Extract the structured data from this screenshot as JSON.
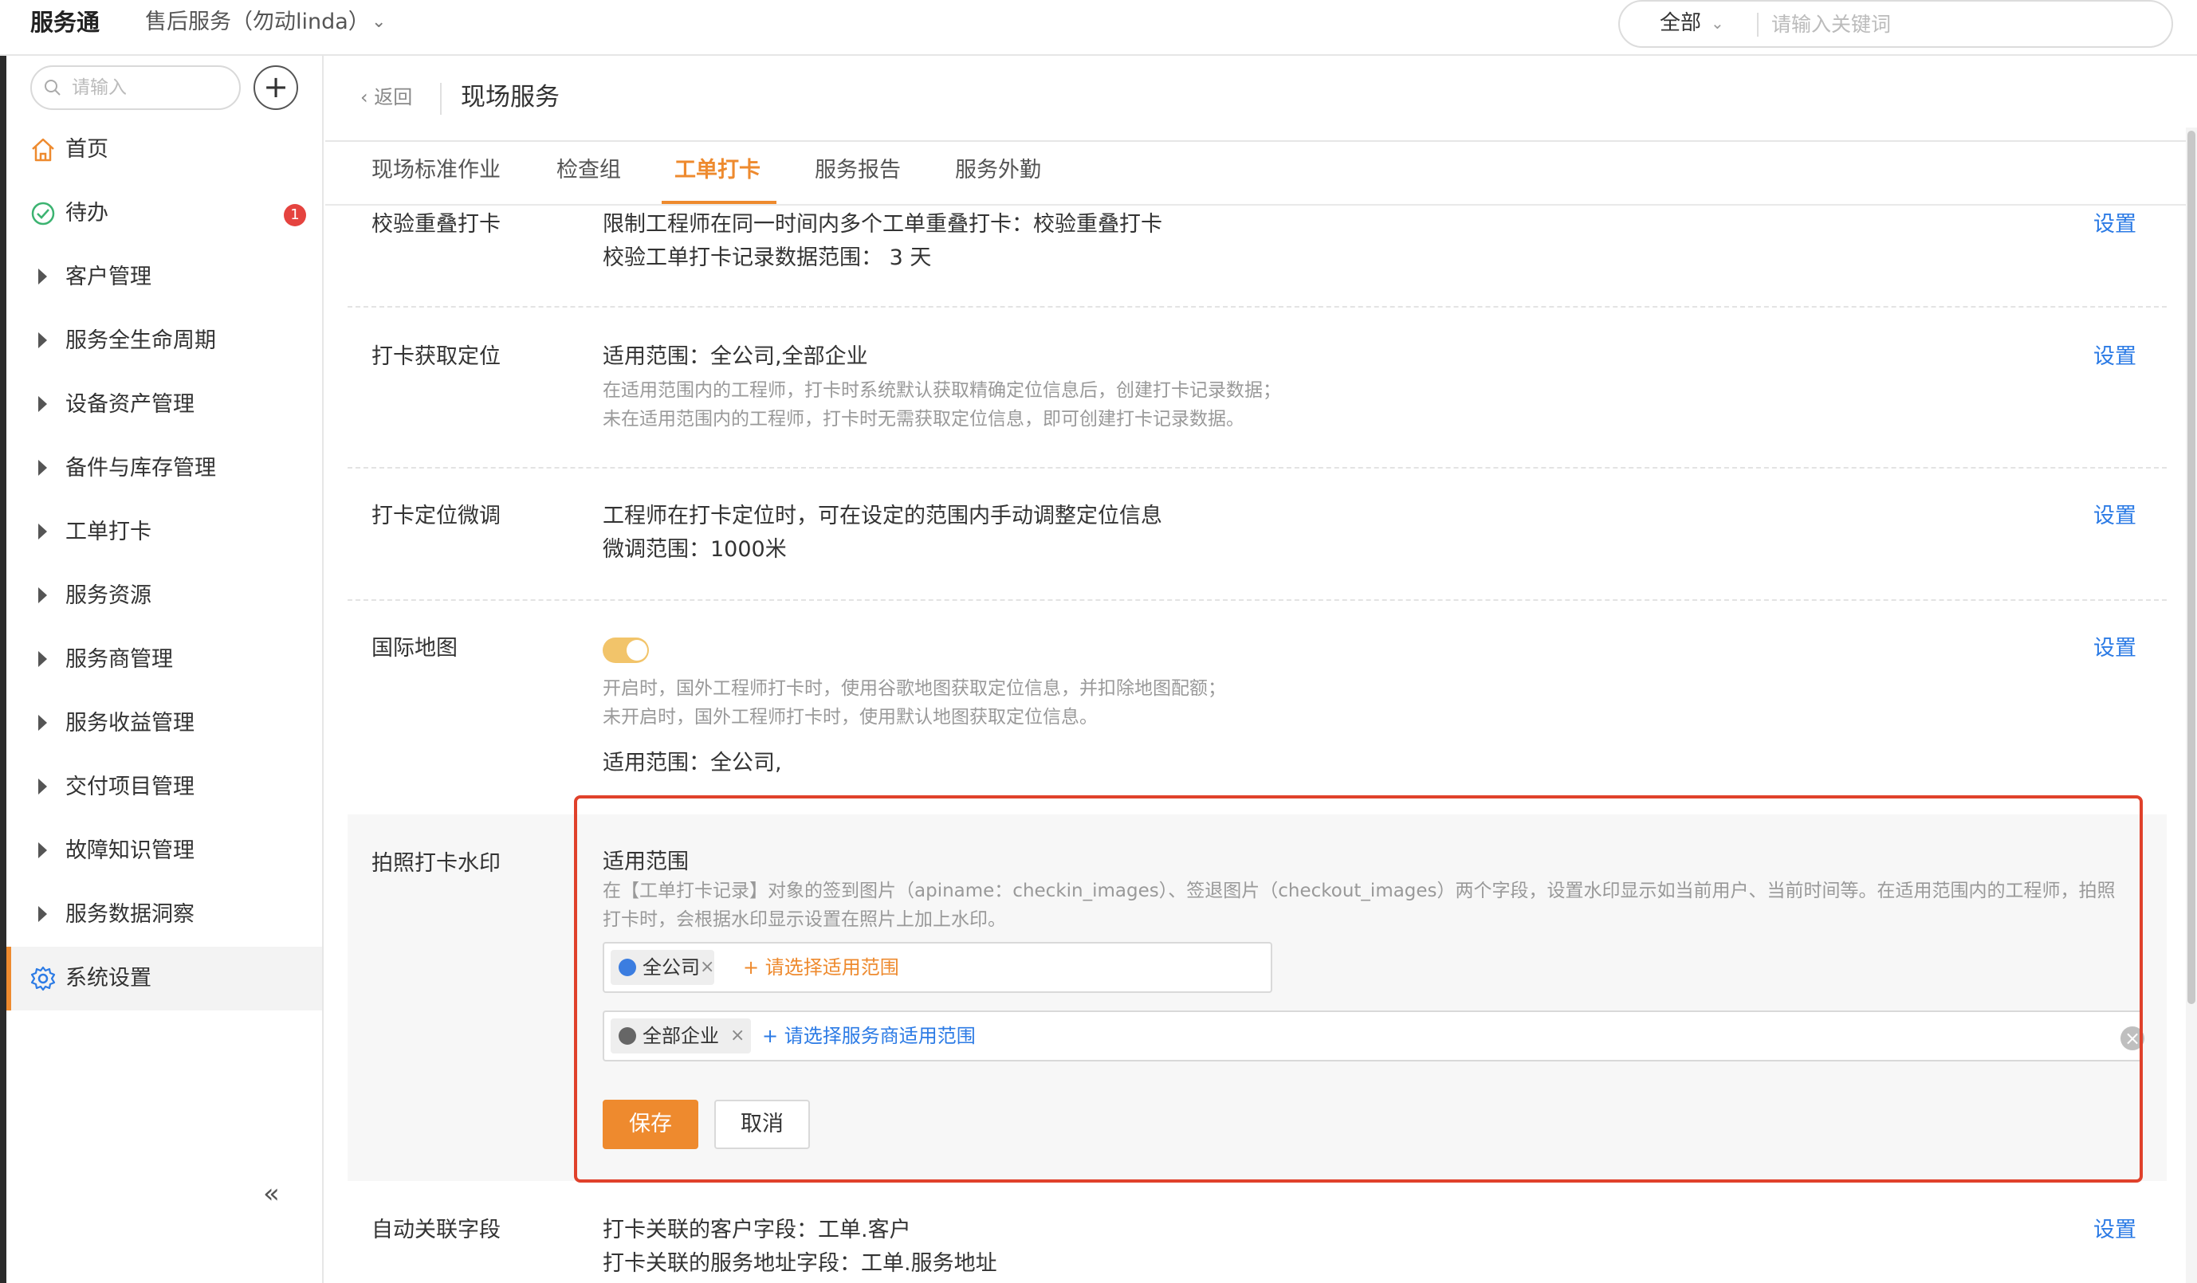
{
  "topbar": {
    "brand": "服务通",
    "tenant": "售后服务（勿动linda）",
    "scope": "全部",
    "search_placeholder": "请输入关键词"
  },
  "sidebar": {
    "search_placeholder": "请输入",
    "todo_badge": "1",
    "items": [
      {
        "label": "首页",
        "icon": "home-icon"
      },
      {
        "label": "待办",
        "icon": "check-circle-icon"
      },
      {
        "label": "客户管理"
      },
      {
        "label": "服务全生命周期"
      },
      {
        "label": "设备资产管理"
      },
      {
        "label": "备件与库存管理"
      },
      {
        "label": "工单打卡"
      },
      {
        "label": "服务资源"
      },
      {
        "label": "服务商管理"
      },
      {
        "label": "服务收益管理"
      },
      {
        "label": "交付项目管理"
      },
      {
        "label": "故障知识管理"
      },
      {
        "label": "服务数据洞察"
      },
      {
        "label": "系统设置",
        "icon": "gear-icon"
      }
    ]
  },
  "header": {
    "back": "返回",
    "title": "现场服务"
  },
  "tabs": [
    "现场标准作业",
    "检查组",
    "工单打卡",
    "服务报告",
    "服务外勤"
  ],
  "active_tab": "工单打卡",
  "accent_color": "#ee8a2e",
  "link_color": "#2c7be5",
  "highlight_color": "#e0412b",
  "sections": {
    "overlap": {
      "title": "校验重叠打卡",
      "line1": "限制工程师在同一时间内多个工单重叠打卡：校验重叠打卡",
      "line2": "校验工单打卡记录数据范围： 3 天",
      "action": "设置"
    },
    "location": {
      "title": "打卡获取定位",
      "line1": "适用范围：全公司,全部企业",
      "desc1": "在适用范围内的工程师，打卡时系统默认获取精确定位信息后，创建打卡记录数据；",
      "desc2": "未在适用范围内的工程师，打卡时无需获取定位信息，即可创建打卡记录数据。",
      "action": "设置"
    },
    "adjust": {
      "title": "打卡定位微调",
      "line1": "工程师在打卡定位时，可在设定的范围内手动调整定位信息",
      "line2": "微调范围：1000米",
      "action": "设置"
    },
    "intl_map": {
      "title": "国际地图",
      "enabled": true,
      "desc1": "开启时，国外工程师打卡时，使用谷歌地图获取定位信息，并扣除地图配额；",
      "desc2": "未开启时，国外工程师打卡时，使用默认地图获取定位信息。",
      "line1": "适用范围：全公司,",
      "action": "设置"
    },
    "watermark": {
      "title": "拍照打卡水印",
      "scope_label": "适用范围",
      "desc1": "在【工单打卡记录】对象的签到图片（apiname：checkin_images）、签退图片（checkout_images）两个字段，设置水印显示如当前用户、当前时间等。在适用范围内的工程师，拍照",
      "desc2": "打卡时，会根据水印显示设置在照片上加上水印。",
      "chip1": "全公司",
      "add1": "+ 请选择适用范围",
      "chip2": "全部企业",
      "add2": "+ 请选择服务商适用范围",
      "save": "保存",
      "cancel": "取消"
    },
    "auto_link": {
      "title": "自动关联字段",
      "line1": "打卡关联的客户字段：工单.客户",
      "line2": "打卡关联的服务地址字段：工单.服务地址",
      "action": "设置"
    }
  }
}
